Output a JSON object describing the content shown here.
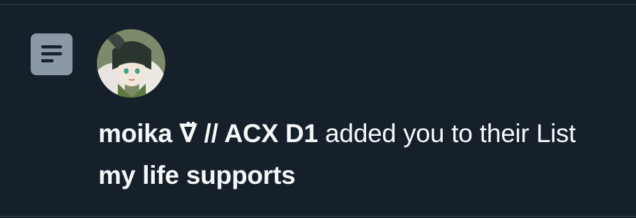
{
  "notification": {
    "icon": "list-icon",
    "avatar": "user-avatar",
    "actor_name": "moika ∇̈ // ACX D1",
    "action_text": " added you to their List ",
    "list_name": "my life supports"
  },
  "colors": {
    "background": "#15202b",
    "text": "#f7f9f9",
    "icon_bg": "#8b98a5",
    "divider": "#38444d"
  }
}
